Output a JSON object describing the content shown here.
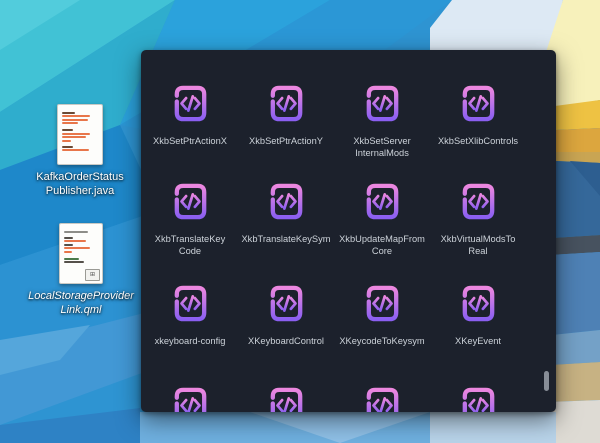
{
  "desktop": {
    "icons": [
      {
        "label": "KafkaOrderStatus\nPublisher.java",
        "type": "java-source-thumbnail"
      },
      {
        "label": "LocalStorageProvider\nLink.qml",
        "type": "qml-symlink-thumbnail",
        "style": "italic"
      }
    ],
    "wallpaper_palette": {
      "teal": "#41c2d5",
      "blue": "#2c92d2",
      "light_blue_white": "#dde9f4",
      "pale_yellow": "#f7f1bb",
      "gold": "#eec243",
      "steel_blue": "#35689a",
      "slate": "#47525f",
      "tan": "#c7b283",
      "light_gray": "#dedbd4"
    }
  },
  "folder_view": {
    "items": [
      {
        "label": "XkbSetPtrActionX"
      },
      {
        "label": "XkbSetPtrActionY"
      },
      {
        "label": "XkbSetServer\nInternalMods"
      },
      {
        "label": "XkbSetXlibControls"
      },
      {
        "label": "XkbTranslateKey\nCode"
      },
      {
        "label": "XkbTranslateKeySym"
      },
      {
        "label": "XkbUpdateMapFrom\nCore"
      },
      {
        "label": "XkbVirtualModsTo\nReal"
      },
      {
        "label": "xkeyboard-config"
      },
      {
        "label": "XKeyboardControl"
      },
      {
        "label": "XKeycodeToKeysym"
      },
      {
        "label": "XKeyEvent"
      },
      {
        "label": ""
      },
      {
        "label": ""
      },
      {
        "label": ""
      },
      {
        "label": ""
      }
    ],
    "icon_type": "code-file-icon",
    "colors": {
      "window_bg": "#1c212c",
      "label": "#ccd2d9",
      "icon_gradient_top": "#ec87df",
      "icon_gradient_bottom": "#8b5ff1",
      "scrollbar_thumb": "#878d97"
    }
  }
}
